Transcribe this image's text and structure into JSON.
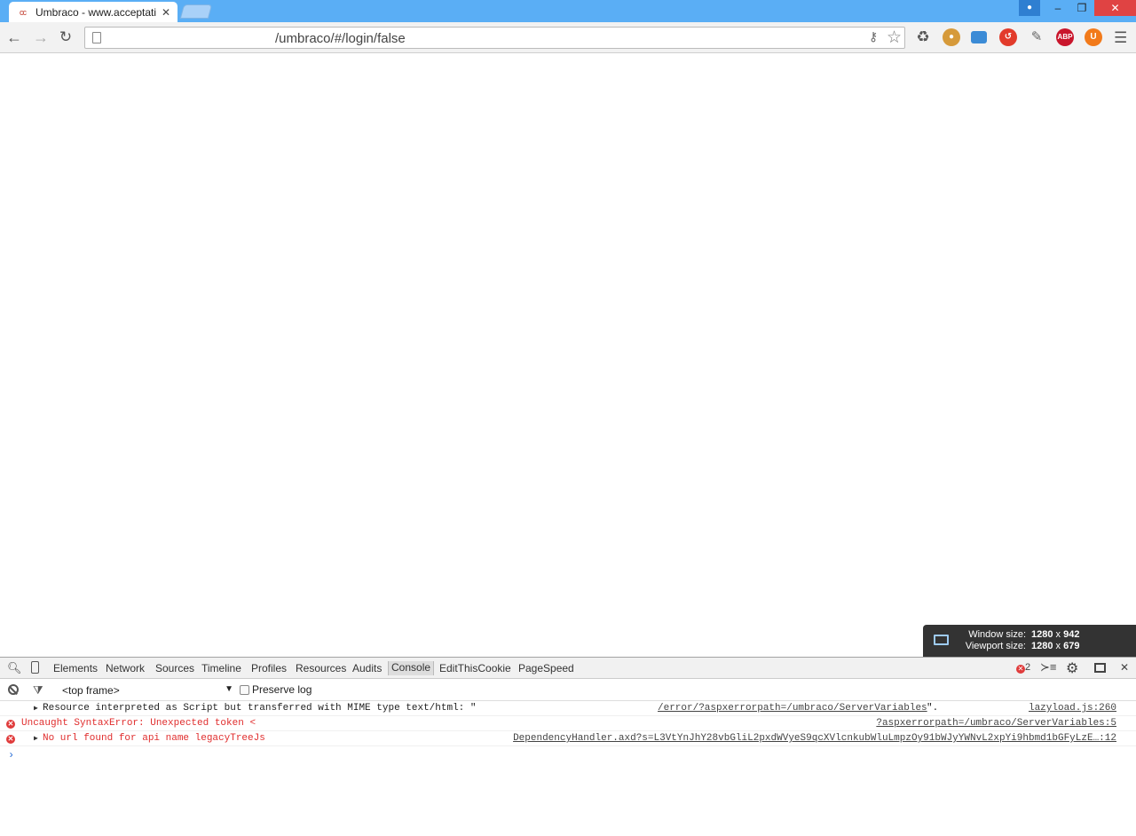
{
  "browser": {
    "tab": {
      "title": "Umbraco - www.acceptati",
      "favicon": "umbraco-favicon"
    },
    "address": {
      "url": "/umbraco/#/login/false"
    }
  },
  "window_size_overlay": {
    "window_label": "Window size:",
    "window_width": "1280",
    "window_height": "942",
    "viewport_label": "Viewport size:",
    "viewport_width": "1280",
    "viewport_height": "679",
    "times": "x"
  },
  "devtools": {
    "tabs": [
      "Elements",
      "Network",
      "Sources",
      "Timeline",
      "Profiles",
      "Resources",
      "Audits",
      "Console",
      "EditThisCookie",
      "PageSpeed"
    ],
    "active_tab": "Console",
    "error_count": "2",
    "frame": "<top frame>",
    "preserve_log": "Preserve log",
    "messages": [
      {
        "level": "warning",
        "text": "Resource interpreted as Script but transferred with MIME type text/html: \"",
        "link": "/error/?aspxerrorpath=/umbraco/ServerVariables",
        "suffix": "\".",
        "source": "lazyload.js:260"
      },
      {
        "level": "error",
        "text": "Uncaught SyntaxError: Unexpected token <",
        "source": "?aspxerrorpath=/umbraco/ServerVariables:5"
      },
      {
        "level": "error",
        "text": "No url found for api name legacyTreeJs",
        "source": "DependencyHandler.axd?s=L3VtYnJhY28vbGliL2pxdWVyeS9qcXVlcnkubWluLmpzOy91bWJyYWNvL2xpYi9hbmd1bGFyLzE…:12"
      }
    ],
    "prompt": "›"
  },
  "colors": {
    "titlebar": "#5aaef5",
    "error": "#e02d2d",
    "close_button": "#e04343"
  }
}
